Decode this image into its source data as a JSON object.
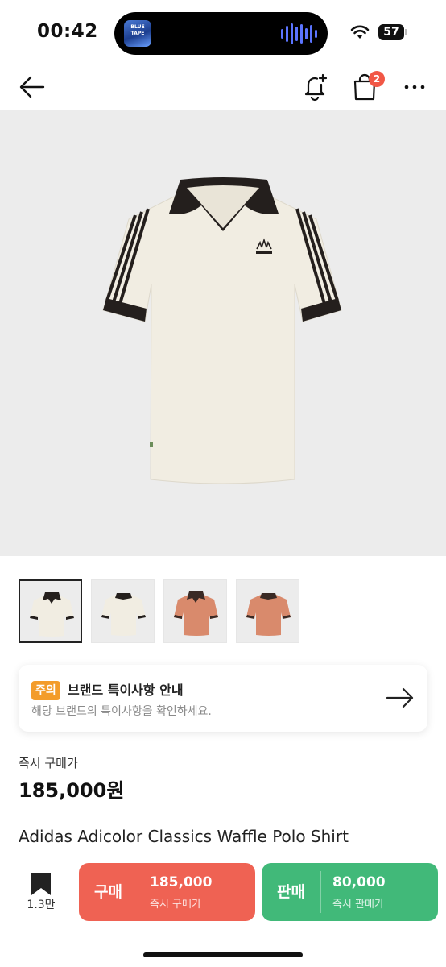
{
  "status_bar": {
    "time": "00:42",
    "now_playing_art_text": "BLUE TAPE",
    "battery_level": "57"
  },
  "nav": {
    "cart_count": "2"
  },
  "product": {
    "thumbnails": [
      {
        "variant": "ivory-black",
        "color": "#f1eee3",
        "selected": true
      },
      {
        "variant": "ivory-black",
        "color": "#f1eee3",
        "selected": false
      },
      {
        "variant": "salmon-brown",
        "color": "#d98a6c",
        "selected": false
      },
      {
        "variant": "salmon-brown",
        "color": "#d98a6c",
        "selected": false
      }
    ],
    "name": "Adidas Adicolor Classics Waffle Polo Shirt"
  },
  "notice": {
    "badge": "주의",
    "title": "브랜드 특이사항 안내",
    "description": "해당 브랜드의 특이사항을 확인하세요."
  },
  "price": {
    "label": "즉시 구매가",
    "value": "185,000원"
  },
  "bottom_bar": {
    "wish_count": "1.3만",
    "buy": {
      "label": "구매",
      "price": "185,000",
      "sub": "즉시 구매가"
    },
    "sell": {
      "label": "판매",
      "price": "80,000",
      "sub": "즉시 판매가"
    }
  },
  "colors": {
    "buy": "#ef6253",
    "sell": "#41b979",
    "badge": "#f15746",
    "notice_badge": "#f39c2a"
  }
}
